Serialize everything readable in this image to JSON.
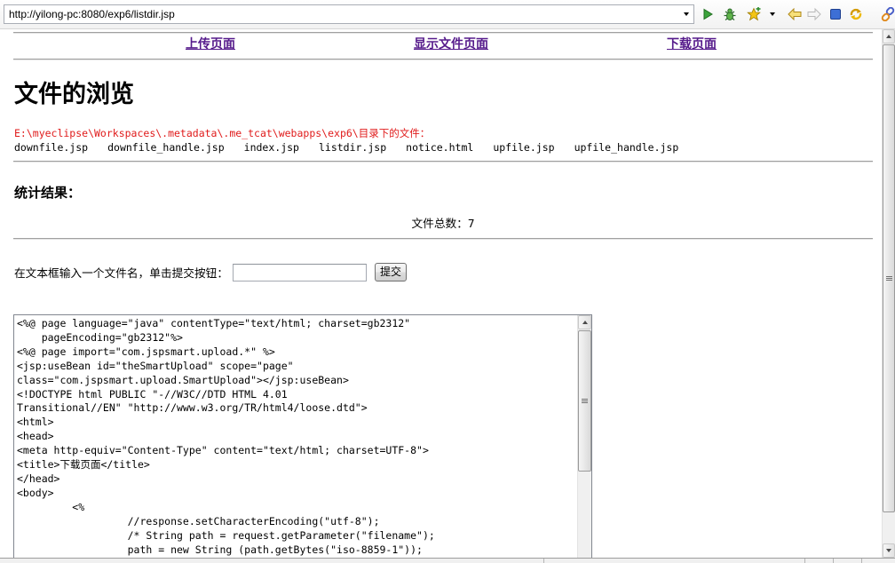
{
  "browser_toolbar": {
    "url": "http://yilong-pc:8080/exp6/listdir.jsp",
    "icons": [
      "url-history-dropdown-icon",
      "go-icon",
      "debug-bug-icon",
      "bookmark-star-icon",
      "bookmark-dropdown-icon",
      "back-arrow-icon",
      "forward-arrow-icon",
      "stop-icon",
      "refresh-icon",
      "chain-link-icon"
    ]
  },
  "page": {
    "nav_links": [
      {
        "label": "上传页面"
      },
      {
        "label": "显示文件页面"
      },
      {
        "label": "下载页面"
      }
    ],
    "heading": "文件的浏览",
    "directory_path": "E:\\myeclipse\\Workspaces\\.metadata\\.me_tcat\\webapps\\exp6\\目录下的文件：",
    "files": [
      "downfile.jsp",
      "downfile_handle.jsp",
      "index.jsp",
      "listdir.jsp",
      "notice.html",
      "upfile.jsp",
      "upfile_handle.jsp"
    ],
    "stats_heading": "统计结果：",
    "file_count": {
      "label": "文件总数：",
      "value": 7
    },
    "form": {
      "prompt": "在文本框输入一个文件名，单击提交按钮：",
      "submit_label": "提交"
    },
    "code_editor": {
      "value": "<%@ page language=\"java\" contentType=\"text/html; charset=gb2312\"\n    pageEncoding=\"gb2312\"%>\n<%@ page import=\"com.jspsmart.upload.*\" %>\n<jsp:useBean id=\"theSmartUpload\" scope=\"page\"\nclass=\"com.jspsmart.upload.SmartUpload\"></jsp:useBean>\n<!DOCTYPE html PUBLIC \"-//W3C//DTD HTML 4.01\nTransitional//EN\" \"http://www.w3.org/TR/html4/loose.dtd\">\n<html>\n<head>\n<meta http-equiv=\"Content-Type\" content=\"text/html; charset=UTF-8\">\n<title>下载页面</title>\n</head>\n<body>\n         <%\n                  //response.setCharacterEncoding(\"utf-8\");\n                  /* String path = request.getParameter(\"filename\");\n                  path = new String (path.getBytes(\"iso-8859-1\"));"
    }
  },
  "colors": {
    "link": "#551a8b",
    "directory_path": "#e01b1b"
  }
}
